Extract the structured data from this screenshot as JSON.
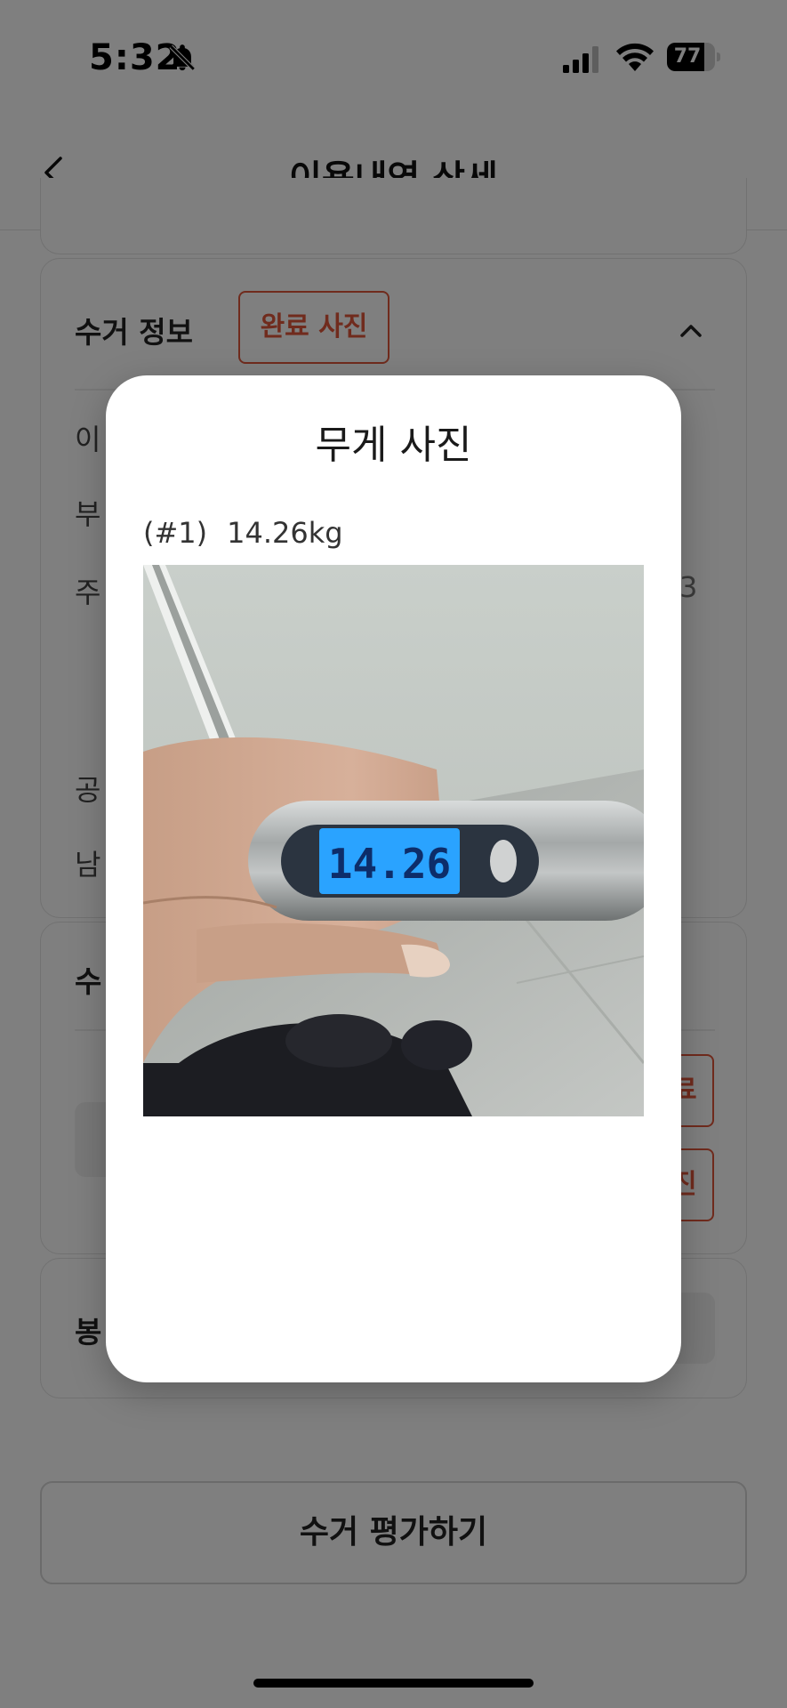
{
  "status_bar": {
    "time": "5:32",
    "battery": "77",
    "battery_level": 0.77,
    "icons": [
      "bell-off-icon",
      "signal-icon",
      "wifi-icon",
      "battery-icon"
    ]
  },
  "header": {
    "title": "이용내역 상세",
    "back_icon": "chevron-left-icon"
  },
  "background": {
    "collection_card": {
      "title": "수거 정보",
      "badge": "완료 사진",
      "rows": [
        "이",
        "부",
        "주",
        "공",
        "남"
      ],
      "partial_value": "3"
    },
    "second_card": {
      "title": "수",
      "buttons": [
        "료",
        "진"
      ]
    },
    "third_card": {
      "title": "봉"
    },
    "rate_button": "수거 평가하기"
  },
  "modal": {
    "title": "무게 사진",
    "photo_index": "(#1)",
    "photo_weight": "14.26kg",
    "scale_display": "14.26"
  },
  "colors": {
    "accent": "#e0573a",
    "scale_lcd": "#2aa3ff"
  }
}
